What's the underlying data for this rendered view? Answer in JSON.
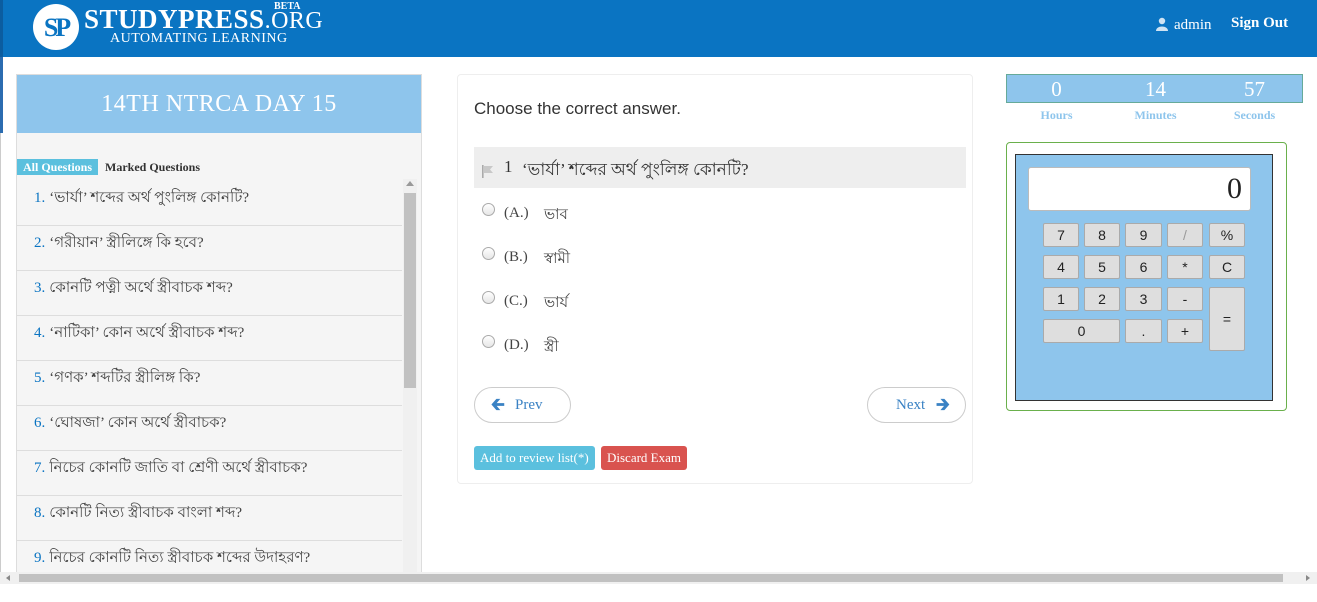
{
  "brand": {
    "logo_letters": "SP",
    "name_main": "STUDYPRESS",
    "name_suffix": ".ORG",
    "beta": "BETA",
    "tagline": "AUTOMATING LEARNING",
    "color": "#0a74c2"
  },
  "header": {
    "username": "admin",
    "signout_label": "Sign Out",
    "user_icon": "user-icon"
  },
  "exam": {
    "title": "14TH NTRCA DAY 15",
    "tabs": {
      "all": "All Questions",
      "marked": "Marked Questions"
    },
    "questions": [
      {
        "num": "1.",
        "text": "‘ভার্যা’ শব্দের অর্থ পুংলিঙ্গ কোনটি?"
      },
      {
        "num": "2.",
        "text": "‘গরীয়ান’ স্ত্রীলিঙ্গে কি হবে?"
      },
      {
        "num": "3.",
        "text": "কোনটি পত্নী অর্থে স্ত্রীবাচক শব্দ?"
      },
      {
        "num": "4.",
        "text": "‘নাটিকা’ কোন অর্থে স্ত্রীবাচক শব্দ?"
      },
      {
        "num": "5.",
        "text": "‘গণক’ শব্দটির স্ত্রীলিঙ্গ কি?"
      },
      {
        "num": "6.",
        "text": "‘ঘোষজা’ কোন অর্থে স্ত্রীবাচক?"
      },
      {
        "num": "7.",
        "text": "নিচের কোনটি জাতি বা শ্রেণী অর্থে স্ত্রীবাচক?"
      },
      {
        "num": "8.",
        "text": "কোনটি নিত্য স্ত্রীবাচক বাংলা শব্দ?"
      },
      {
        "num": "9.",
        "text": "নিচের কোনটি নিত্য স্ত্রীবাচক শব্দের উদাহরণ?"
      }
    ]
  },
  "main": {
    "instruction": "Choose the correct answer.",
    "current_number": "1",
    "current_question": "‘ভার্যা’ শব্দের অর্থ পুংলিঙ্গ কোনটি?",
    "options": [
      {
        "label": "(A.)",
        "text": "ভাব"
      },
      {
        "label": "(B.)",
        "text": "স্বামী"
      },
      {
        "label": "(C.)",
        "text": "ভার্য"
      },
      {
        "label": "(D.)",
        "text": "স্ত্রী"
      }
    ],
    "prev_label": "Prev",
    "next_label": "Next",
    "review_label": "Add to review list(*)",
    "discard_label": "Discard Exam"
  },
  "timer": {
    "hours": "0",
    "minutes": "14",
    "seconds": "57",
    "hours_label": "Hours",
    "minutes_label": "Minutes",
    "seconds_label": "Seconds"
  },
  "calculator": {
    "display": "0",
    "keys": [
      "7",
      "8",
      "9",
      "/",
      "%",
      "4",
      "5",
      "6",
      "*",
      "C",
      "1",
      "2",
      "3",
      "-",
      "=",
      "0",
      ".",
      "+"
    ]
  }
}
